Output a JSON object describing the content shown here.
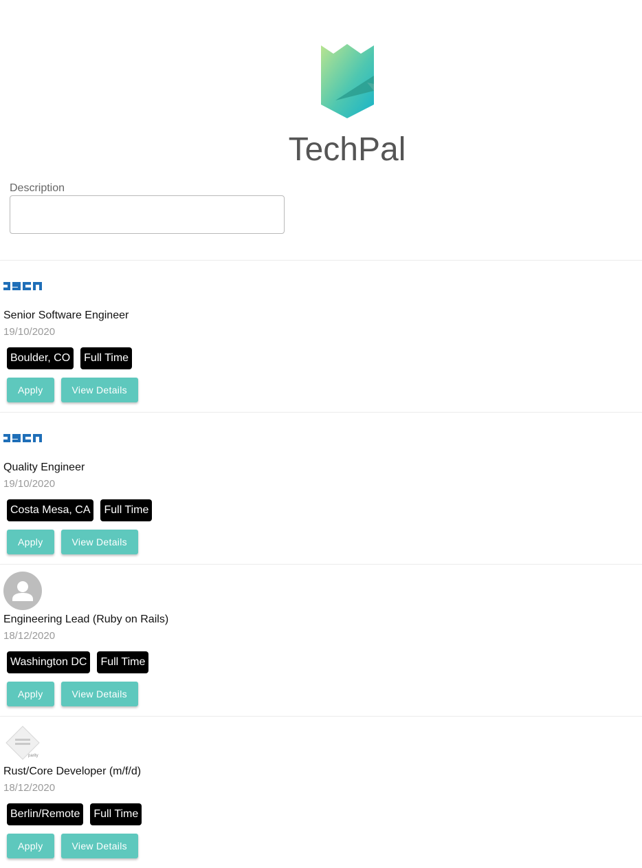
{
  "app": {
    "title": "TechPal",
    "accent_color": "#5ec8bd"
  },
  "search": {
    "label": "Description",
    "value": "",
    "placeholder": ""
  },
  "jobs": [
    {
      "logo": "company-logo-text",
      "title": "Senior Software Engineer",
      "date": "19/10/2020",
      "location": "Boulder, CO",
      "type": "Full Time",
      "apply_label": "Apply",
      "details_label": "View Details"
    },
    {
      "logo": "company-logo-text",
      "title": "Quality Engineer",
      "date": "19/10/2020",
      "location": "Costa Mesa, CA",
      "type": "Full Time",
      "apply_label": "Apply",
      "details_label": "View Details"
    },
    {
      "logo": "avatar-placeholder-icon",
      "title": "Engineering Lead (Ruby on Rails)",
      "date": "18/12/2020",
      "location": "Washington DC",
      "type": "Full Time",
      "apply_label": "Apply",
      "details_label": "View Details"
    },
    {
      "logo": "company-logo-parity",
      "title": "Rust/Core Developer (m/f/d)",
      "date": "18/12/2020",
      "location": "Berlin/Remote",
      "type": "Full Time",
      "apply_label": "Apply",
      "details_label": "View Details"
    }
  ]
}
